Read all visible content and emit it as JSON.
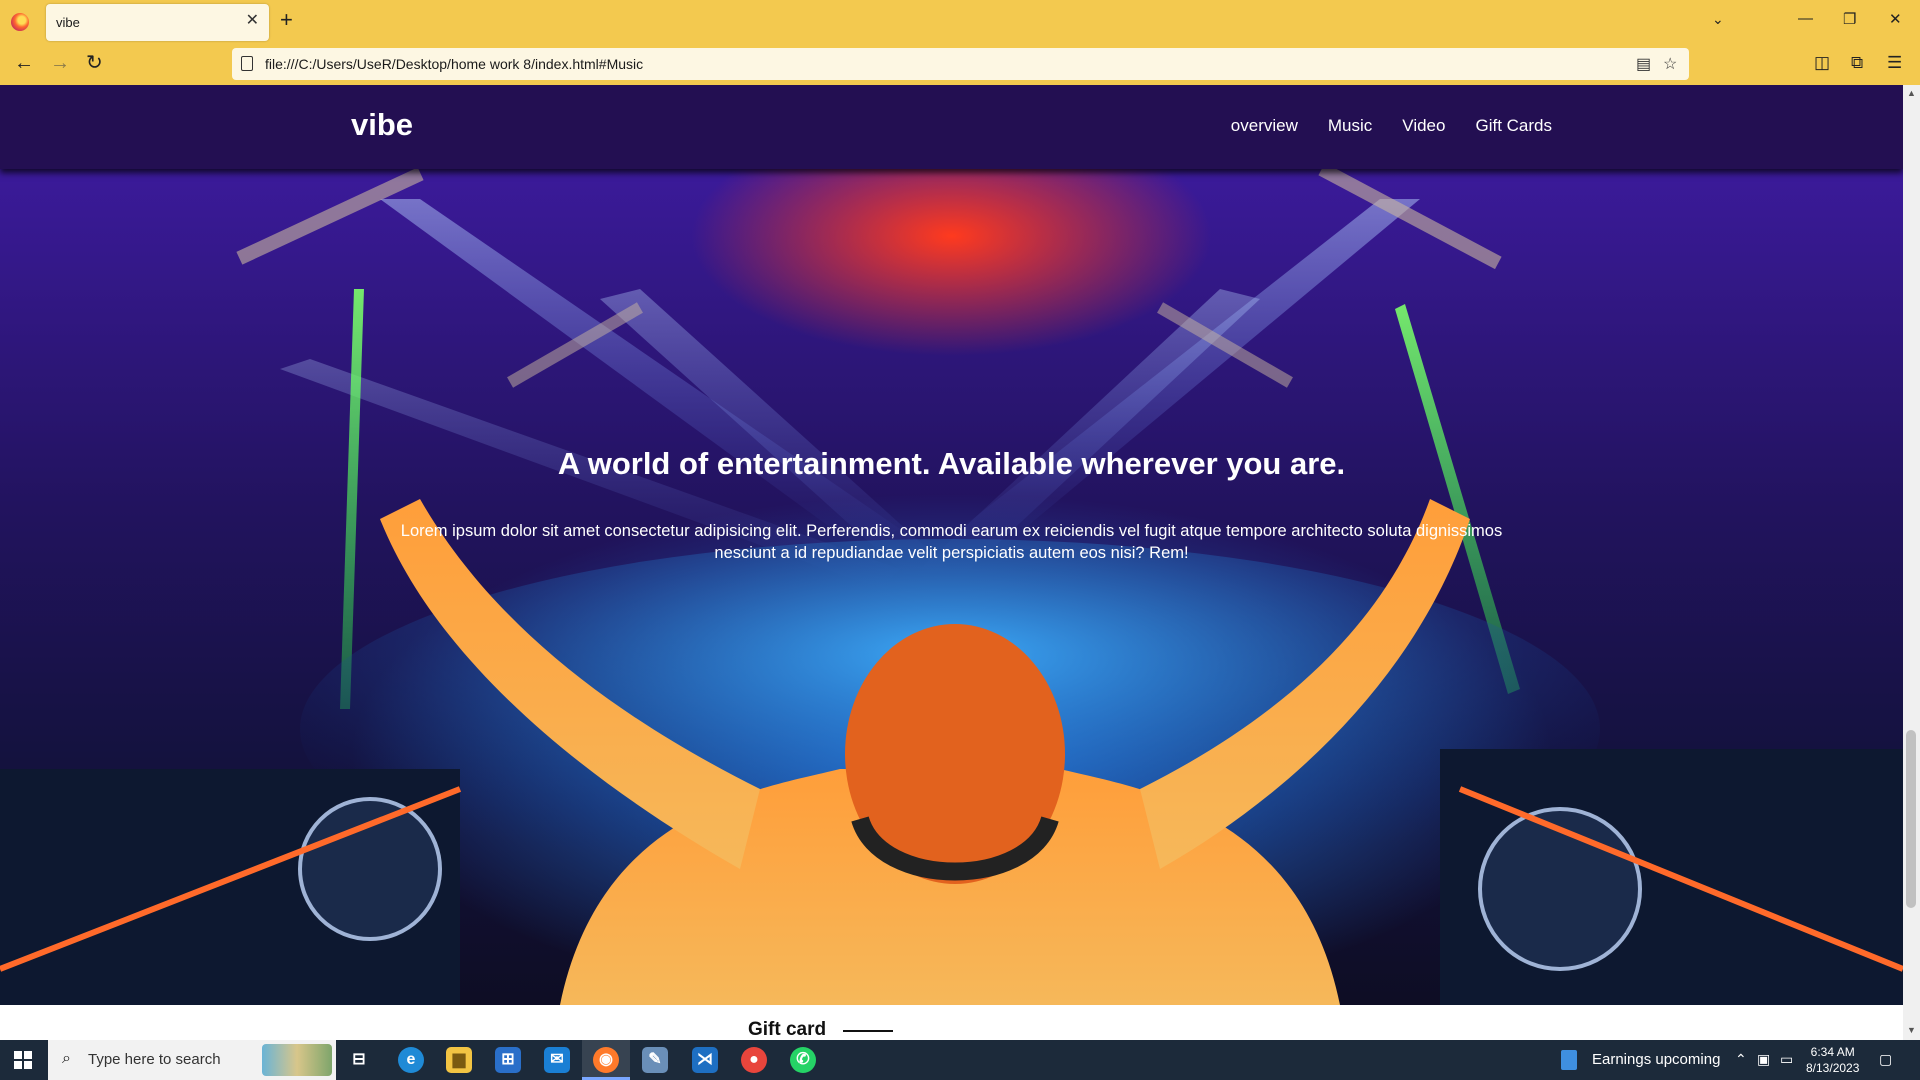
{
  "browser": {
    "tab_title": "vibe",
    "url": "file:///C:/Users/UseR/Desktop/home work 8/index.html#Music"
  },
  "site": {
    "brand": "vibe",
    "nav": [
      {
        "label": "overview"
      },
      {
        "label": "Music"
      },
      {
        "label": "Video"
      },
      {
        "label": "Gift Cards"
      }
    ],
    "hero": {
      "title": "A world of entertainment. Available wherever you are.",
      "text": "Lorem ipsum dolor sit amet consectetur adipisicing elit. Perferendis, commodi earum ex reiciendis vel fugit atque tempore architecto soluta dignissimos nesciunt a id repudiandae velit perspiciatis autem eos nisi? Rem!"
    },
    "section_heading": "Gift card"
  },
  "taskbar": {
    "search_placeholder": "Type here to search",
    "news_widget": "Earnings upcoming",
    "time": "6:34 AM",
    "date": "8/13/2023"
  },
  "colors": {
    "browser_chrome": "#f3c94f",
    "site_header": "#230f52",
    "taskbar": "#1c2a3a"
  }
}
